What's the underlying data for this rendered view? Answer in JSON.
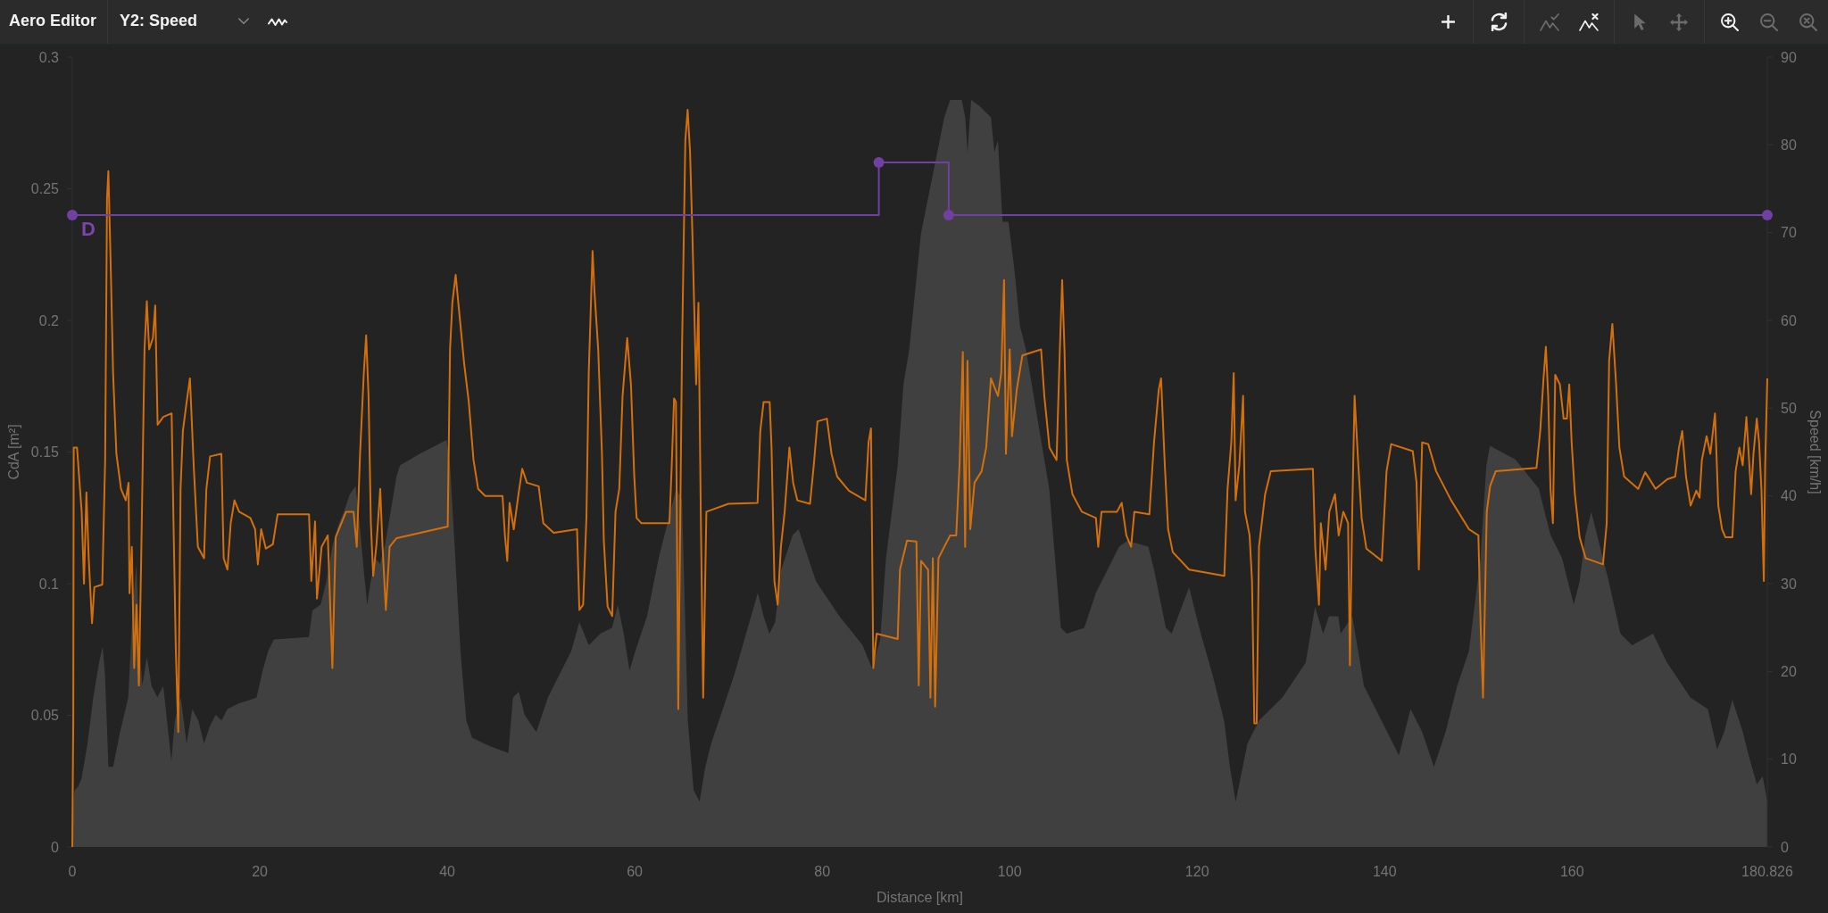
{
  "toolbar": {
    "title": "Aero Editor",
    "series_select": {
      "value": "Y2: Speed"
    },
    "groups": [
      {
        "buttons": [
          {
            "kind": "add",
            "disabled": false
          }
        ]
      },
      {
        "buttons": [
          {
            "kind": "refresh",
            "disabled": false
          }
        ]
      },
      {
        "buttons": [
          {
            "kind": "mountain-check",
            "disabled": true
          },
          {
            "kind": "mountain-x",
            "disabled": false
          }
        ]
      },
      {
        "buttons": [
          {
            "kind": "pointer",
            "disabled": true
          },
          {
            "kind": "move",
            "disabled": true
          }
        ]
      },
      {
        "buttons": [
          {
            "kind": "zoom-in",
            "disabled": false
          },
          {
            "kind": "zoom-out",
            "disabled": true
          },
          {
            "kind": "zoom-reset",
            "disabled": true
          }
        ]
      }
    ]
  },
  "plot": {
    "chart_data": {
      "type": "line",
      "xlabel": "Distance [km]",
      "ylabel": "CdA [m²]",
      "y2label": "Speed [km/h]",
      "xlim": [
        0,
        180.826
      ],
      "ylim": [
        0,
        0.3
      ],
      "y2lim": [
        0,
        90
      ],
      "xticks": [
        0,
        20,
        40,
        60,
        80,
        100,
        120,
        140,
        160,
        180.826
      ],
      "yticks": [
        0,
        0.05,
        0.1,
        0.15,
        0.2,
        0.25,
        0.3
      ],
      "y2ticks": [
        0,
        10,
        20,
        30,
        40,
        50,
        60,
        70,
        80,
        90
      ],
      "x": [
        0,
        0.1,
        0.15,
        0.5,
        1,
        1.25,
        1.5,
        1.75,
        2.1,
        2.35,
        3.2,
        3.5,
        3.7,
        3.85,
        4.1,
        4.35,
        4.7,
        5.2,
        5.7,
        6,
        6.1,
        6.35,
        6.6,
        6.85,
        7.1,
        7.35,
        7.7,
        7.95,
        8.2,
        8.6,
        8.85,
        9.1,
        9.7,
        10.6,
        10.8,
        11.05,
        11.3,
        11.55,
        11.8,
        12.2,
        12.55,
        12.95,
        13.4,
        14.05,
        14.3,
        14.7,
        15.9,
        16.15,
        16.55,
        16.9,
        17.3,
        17.8,
        19,
        19.5,
        19.8,
        20.15,
        20.65,
        21.4,
        21.9,
        25.25,
        25.5,
        25.9,
        26.1,
        26.6,
        27.25,
        27.75,
        28.1,
        29.2,
        30,
        30.35,
        30.7,
        31.1,
        31.35,
        31.6,
        31.85,
        32.1,
        32.45,
        32.85,
        33.1,
        33.45,
        33.85,
        34.6,
        40.05,
        40.3,
        40.55,
        40.9,
        41.3,
        41.8,
        42.3,
        42.8,
        43.3,
        44.05,
        45.9,
        46.15,
        46.4,
        46.65,
        47.1,
        47.6,
        48,
        48.5,
        49.75,
        50.25,
        51.35,
        53.85,
        54.1,
        54.5,
        54.85,
        55.1,
        55.5,
        55.7,
        56.1,
        56.5,
        56.7,
        57.1,
        57.6,
        57.95,
        58.35,
        58.7,
        59.2,
        59.6,
        59.95,
        60.2,
        60.7,
        63.7,
        63.95,
        64.2,
        64.4,
        64.65,
        65.05,
        65.4,
        65.65,
        65.9,
        66.15,
        66.55,
        66.8,
        67.05,
        67.3,
        67.65,
        70,
        73.1,
        73.4,
        73.75,
        74.4,
        74.6,
        74.9,
        75.25,
        75.6,
        76,
        76.5,
        76.9,
        77.35,
        78.7,
        79.1,
        79.5,
        80.5,
        81,
        81.6,
        82.85,
        84.6,
        84.95,
        85.2,
        85.45,
        85.8,
        88.05,
        88.3,
        89.05,
        90.05,
        90.3,
        90.55,
        91.3,
        91.55,
        91.8,
        92.05,
        92.4,
        93.65,
        94.3,
        94.65,
        95,
        95.25,
        95.5,
        95.8,
        96.25,
        97,
        97.5,
        98,
        98.75,
        99.1,
        99.4,
        99.6,
        100,
        100.25,
        100.75,
        101.35,
        103.35,
        103.7,
        104.25,
        105,
        105.35,
        105.6,
        105.85,
        106.1,
        106.7,
        107.7,
        109.2,
        109.45,
        109.8,
        111.45,
        111.95,
        112.45,
        112.95,
        113.3,
        114.9,
        115.4,
        115.9,
        116.15,
        116.55,
        116.9,
        117.4,
        119.15,
        122.9,
        123.25,
        123.65,
        123.9,
        124.1,
        124.5,
        124.9,
        125.1,
        125.6,
        125.85,
        126.1,
        126.35,
        126.6,
        127.25,
        127.85,
        132.35,
        132.6,
        133,
        133.2,
        133.7,
        134.1,
        134.7,
        135.1,
        135.6,
        136.1,
        136.3,
        136.55,
        136.8,
        137.2,
        137.55,
        138.05,
        139.7,
        140.2,
        140.7,
        143,
        143.4,
        143.65,
        144,
        144.65,
        145.5,
        147.1,
        149,
        150,
        150.25,
        150.5,
        150.9,
        151.25,
        151.85,
        156.2,
        156.6,
        156.95,
        157.2,
        157.45,
        157.7,
        157.95,
        158.2,
        158.7,
        159.1,
        159.45,
        159.7,
        159.95,
        160.3,
        160.8,
        161.45,
        163.3,
        163.7,
        163.95,
        164.3,
        164.7,
        165.05,
        165.55,
        167.05,
        167.8,
        168.9,
        170.15,
        171,
        171.4,
        171.75,
        172.15,
        172.65,
        173.25,
        173.6,
        173.85,
        174.35,
        174.75,
        175.25,
        175.6,
        176,
        176.35,
        177.1,
        177.45,
        177.85,
        178.2,
        178.6,
        179.1,
        179.35,
        179.7,
        179.95,
        180.2,
        180.45,
        180.6,
        180.826
      ],
      "series": [
        {
          "color": "#d4700c",
          "axis": "y2",
          "values": [
            0,
            14.4,
            45.5,
            45.5,
            38.2,
            30,
            40.4,
            32.9,
            25.5,
            29.6,
            29.9,
            44.1,
            73.9,
            77,
            65.9,
            54,
            44.8,
            40.8,
            39.5,
            41.5,
            28.9,
            34.2,
            20.4,
            27.6,
            18.4,
            32.9,
            56.7,
            62.2,
            56.7,
            58,
            61.7,
            48.1,
            49,
            49.4,
            36.9,
            22.3,
            13.1,
            40.8,
            47.4,
            50.7,
            53.4,
            43.5,
            34.2,
            32.9,
            40.8,
            44.5,
            44.8,
            32.9,
            31.6,
            36.9,
            39.5,
            38.2,
            37.5,
            36.2,
            32.2,
            36.2,
            34,
            34.5,
            37.9,
            37.9,
            30.3,
            37.1,
            28.3,
            34.2,
            35.5,
            20.4,
            35.3,
            38.2,
            38.2,
            34.2,
            44.8,
            54,
            58.3,
            51.4,
            36.9,
            30.9,
            34.5,
            40.8,
            34.2,
            27,
            34.2,
            35.2,
            36.5,
            56.7,
            62,
            65.2,
            60.7,
            55.1,
            50.7,
            44.1,
            40.8,
            40,
            40,
            35.5,
            32.6,
            39.2,
            36.2,
            40.2,
            43.1,
            41.5,
            41.1,
            36.9,
            35.8,
            36.2,
            27,
            27.6,
            37.5,
            54,
            67.9,
            63.3,
            56.7,
            44.8,
            34.9,
            27.4,
            26.3,
            38.2,
            40.8,
            51.4,
            58,
            52.7,
            42.2,
            37.5,
            36.9,
            36.9,
            43.5,
            51.1,
            50.7,
            15.7,
            56.7,
            80.5,
            84,
            79.2,
            69.9,
            52.7,
            62,
            38.2,
            17,
            38.2,
            39.1,
            39.2,
            47.4,
            50.7,
            50.7,
            45.5,
            30.3,
            27.6,
            34.2,
            38.2,
            45.5,
            41.5,
            39.5,
            39.1,
            43.5,
            48.5,
            48.8,
            44.8,
            42.2,
            40.6,
            39.5,
            46.1,
            47.7,
            20.4,
            24.3,
            23.7,
            31.6,
            34.9,
            34.8,
            18.4,
            32.6,
            31.6,
            17,
            32.9,
            16,
            32.9,
            35.5,
            35.5,
            43.5,
            56.4,
            34.2,
            55.4,
            36.2,
            41.5,
            42.8,
            45.5,
            53.4,
            51.4,
            54,
            64.6,
            44.8,
            56.7,
            46.8,
            52.1,
            56,
            56.7,
            51.4,
            45.5,
            44.1,
            56.7,
            64.6,
            56.7,
            44.1,
            40.2,
            38.2,
            37.5,
            34.2,
            38.2,
            38.2,
            39.2,
            35.5,
            34.2,
            38.2,
            37.9,
            46.1,
            52.1,
            53.4,
            43.5,
            36.2,
            33.6,
            31.6,
            30.9,
            40.8,
            46.1,
            54,
            39.5,
            43.5,
            51.4,
            38.2,
            35.5,
            30.3,
            14.1,
            14.1,
            34.2,
            40.2,
            42.8,
            43.1,
            34.2,
            27.6,
            36.9,
            31.6,
            38.2,
            40.2,
            35.5,
            38.2,
            36.9,
            20.7,
            38.2,
            51.4,
            43.5,
            37.5,
            34,
            32.6,
            42.8,
            45.9,
            45.1,
            41.5,
            31.6,
            46.1,
            45.9,
            42.8,
            39.5,
            36.2,
            35.5,
            25,
            17,
            38.2,
            41.1,
            42.8,
            43.2,
            47.4,
            53.4,
            57,
            51.4,
            40.8,
            36.9,
            53.8,
            52.7,
            48.8,
            48.8,
            52.7,
            46.1,
            40.2,
            35.3,
            32.9,
            32.2,
            36.9,
            55.4,
            59.6,
            52.7,
            45.5,
            42.2,
            40.8,
            42.7,
            40.8,
            41.9,
            42.2,
            45.5,
            47.4,
            42.2,
            38.9,
            40.6,
            39.8,
            44.1,
            46.8,
            44.8,
            49.4,
            38.9,
            36.2,
            35.3,
            35.3,
            42.8,
            45.5,
            43.5,
            49,
            40.2,
            44.8,
            48.8,
            46.1,
            40.8,
            30.3,
            43.5,
            53.4
          ]
        },
        {
          "color": "#7040a2",
          "axis": "y",
          "marker": "circle",
          "x": [
            0,
            86.04,
            86.04,
            93.5,
            93.5,
            180.826
          ],
          "values": [
            0.24,
            0.24,
            0.26,
            0.26,
            0.24,
            0.24
          ]
        }
      ],
      "annotations": [
        {
          "text": "D",
          "x": 0,
          "y": 0.24
        }
      ]
    }
  }
}
